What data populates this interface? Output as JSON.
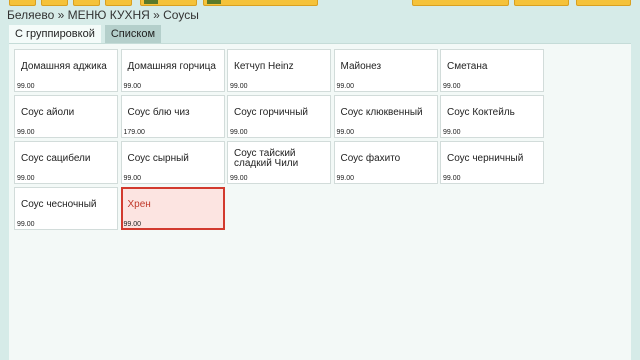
{
  "breadcrumb": "Беляево » МЕНЮ КУХНЯ » Соусы",
  "tabs": [
    {
      "label": "С группировкой",
      "active": true
    },
    {
      "label": "Списком",
      "active": false
    }
  ],
  "items": [
    {
      "name": "Домашняя аджика",
      "price": "99.00"
    },
    {
      "name": "Домашняя горчица",
      "price": "99.00"
    },
    {
      "name": "Кетчуп Heinz",
      "price": "99.00"
    },
    {
      "name": "Майонез",
      "price": "99.00"
    },
    {
      "name": "Сметана",
      "price": "99.00"
    },
    {
      "name": "Соус айоли",
      "price": "99.00"
    },
    {
      "name": "Соус блю чиз",
      "price": "179.00"
    },
    {
      "name": "Соус горчичный",
      "price": "99.00"
    },
    {
      "name": "Соус клюквенный",
      "price": "99.00"
    },
    {
      "name": "Соус Коктейль",
      "price": "99.00"
    },
    {
      "name": "Соус сацибели",
      "price": "99.00"
    },
    {
      "name": "Соус сырный",
      "price": "99.00"
    },
    {
      "name": "Соус тайский сладкий Чили",
      "price": "99.00"
    },
    {
      "name": "Соус фахито",
      "price": "99.00"
    },
    {
      "name": "Соус черничный",
      "price": "99.00"
    },
    {
      "name": "Соус чесночный",
      "price": "99.00"
    },
    {
      "name": "Хрен",
      "price": "99.00",
      "selected": true
    }
  ],
  "colors": {
    "background": "#d6ebe8",
    "toolbar_button": "#f5c23a",
    "selected_border": "#d23a2e",
    "selected_fill": "#fce4e1"
  }
}
